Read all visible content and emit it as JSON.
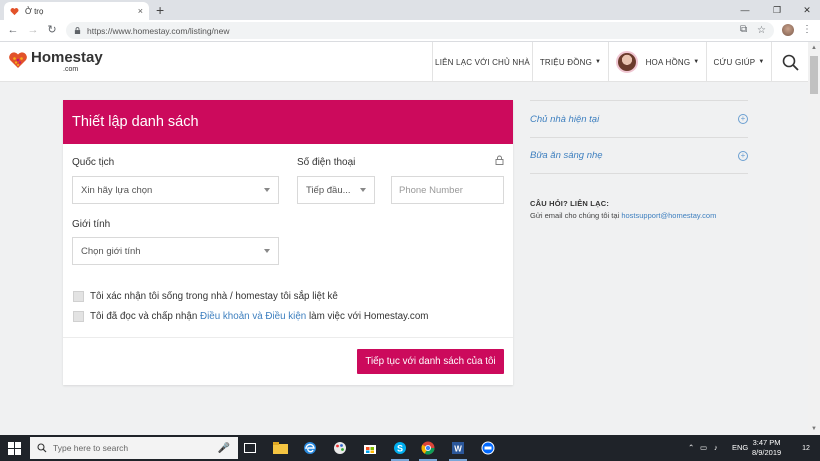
{
  "browser": {
    "tab_title": "Ở trọ",
    "tab_close": "×",
    "new_tab": "+",
    "url": "https://www.homestay.com/listing/new",
    "window_controls": [
      "—",
      "❐",
      "✕"
    ]
  },
  "header": {
    "brand": "Homestay",
    "brand_domain": ".com",
    "nav_contact": "LIÊN LẠC VỚI CHỦ NHÀ",
    "nav_currency": "TRIỆU ĐỒNG",
    "nav_user": "HOA HỒNG",
    "nav_help": "CỨU GIÚP"
  },
  "form": {
    "title": "Thiết lập danh sách",
    "nationality_label": "Quốc tịch",
    "nationality_value": "Xin hãy lựa chọn",
    "phone_label": "Số điện thoại",
    "phone_prefix_value": "Tiếp đầu...",
    "phone_placeholder": "Phone Number",
    "gender_label": "Giới tính",
    "gender_value": "Chọn giới tính",
    "check1": "Tôi xác nhận tôi sống trong nhà / homestay tôi sắp liệt kê",
    "check2_pre": "Tôi đã đọc và chấp nhận ",
    "check2_link": "Điều khoản và Điều kiện",
    "check2_post": " làm việc với Homestay.com",
    "submit": "Tiếp tục với danh sách của tôi"
  },
  "side": {
    "item1": "Chủ nhà hiện tại",
    "item2": "Bữa ăn sáng nhẹ",
    "faq_title": "CÂU HỎI? LIÊN LẠC:",
    "faq_text": "Gửi email cho chúng tôi tại ",
    "faq_email": "hostsupport@homestay.com"
  },
  "taskbar": {
    "search_placeholder": "Type here to search",
    "lang": "ENG",
    "time": "3:47 PM",
    "date": "8/9/2019",
    "notif_count": "12"
  },
  "colors": {
    "brand_primary": "#cc0a5c",
    "link": "#3d7fbf"
  }
}
